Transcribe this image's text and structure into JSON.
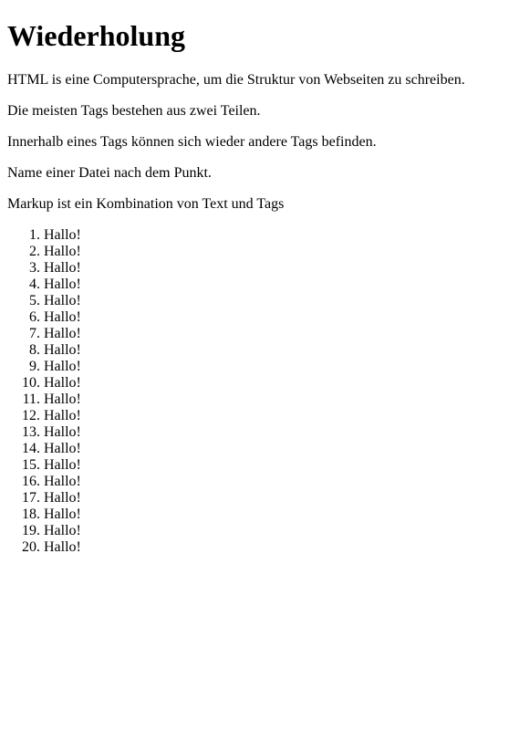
{
  "heading": "Wiederholung",
  "paragraphs": [
    "HTML is eine Computersprache, um die Struktur von Webseiten zu schreiben.",
    "Die meisten Tags bestehen aus zwei Teilen.",
    "Innerhalb eines Tags können sich wieder andere Tags befinden.",
    "Name einer Datei nach dem Punkt.",
    "Markup ist ein Kombination von Text und Tags"
  ],
  "list_items": [
    "Hallo!",
    "Hallo!",
    "Hallo!",
    "Hallo!",
    "Hallo!",
    "Hallo!",
    "Hallo!",
    "Hallo!",
    "Hallo!",
    "Hallo!",
    "Hallo!",
    "Hallo!",
    "Hallo!",
    "Hallo!",
    "Hallo!",
    "Hallo!",
    "Hallo!",
    "Hallo!",
    "Hallo!",
    "Hallo!"
  ]
}
